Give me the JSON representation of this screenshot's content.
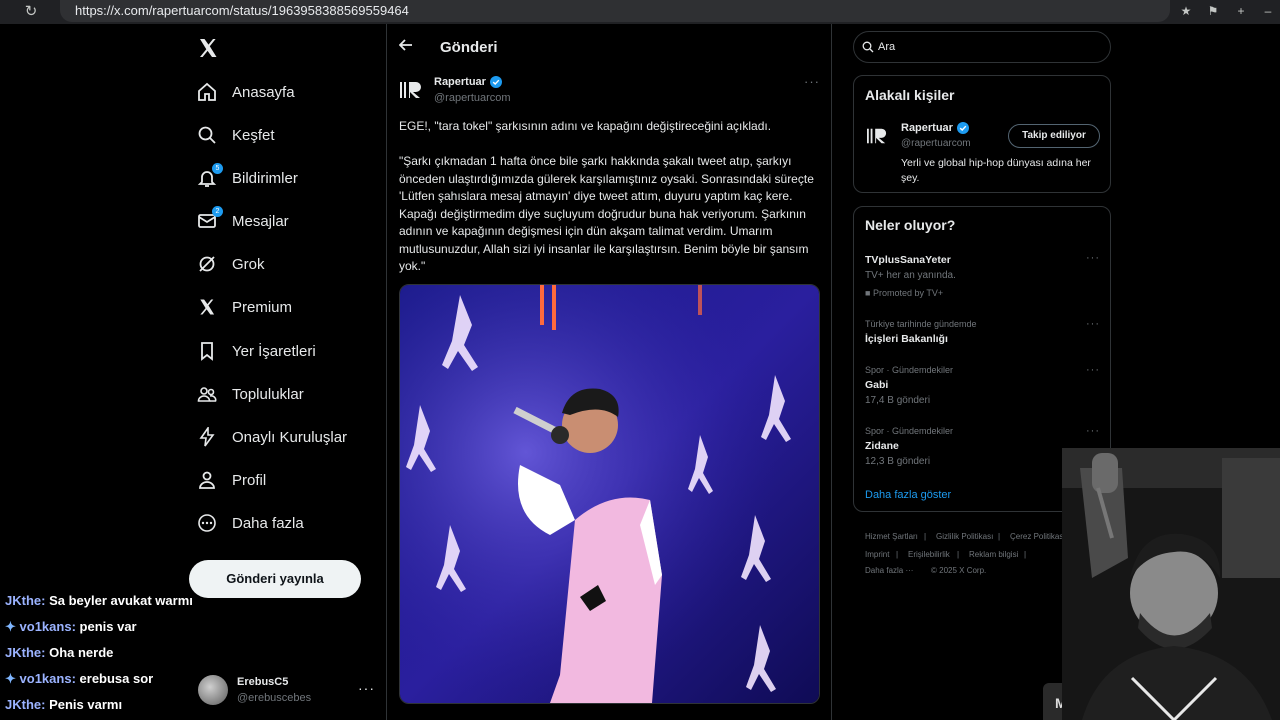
{
  "browser": {
    "url": "https://x.com/rapertuarcom/status/1963958388569559464"
  },
  "nav": {
    "items": [
      {
        "label": "Anasayfa"
      },
      {
        "label": "Keşfet"
      },
      {
        "label": "Bildirimler",
        "badge": "5"
      },
      {
        "label": "Mesajlar",
        "badge": "2"
      },
      {
        "label": "Grok"
      },
      {
        "label": "Premium"
      },
      {
        "label": "Yer İşaretleri"
      },
      {
        "label": "Topluluklar"
      },
      {
        "label": "Onaylı Kuruluşlar"
      },
      {
        "label": "Profil"
      },
      {
        "label": "Daha fazla"
      }
    ],
    "post_button": "Gönderi yayınla",
    "account": {
      "name": "ErebusC5",
      "handle": "@erebuscebes"
    }
  },
  "chat": [
    {
      "user": "JKthe:",
      "msg": "Sa beyler avukat warmı",
      "sword": false
    },
    {
      "user": "vo1kans:",
      "msg": "penis var",
      "sword": true
    },
    {
      "user": "JKthe:",
      "msg": "Oha nerde",
      "sword": false
    },
    {
      "user": "vo1kans:",
      "msg": "erebusa sor",
      "sword": true
    },
    {
      "user": "JKthe:",
      "msg": "Penis varmı",
      "sword": false
    }
  ],
  "tweet": {
    "header_title": "Gönderi",
    "author_name": "Rapertuar",
    "author_handle": "@rapertuarcom",
    "line1": "EGE!, \"tara tokel\" şarkısının adını ve kapağını değiştireceğini açıkladı.",
    "body": "\"Şarkı çıkmadan 1 hafta önce bile şarkı hakkında şakalı tweet atıp, şarkıyı önceden ulaştırdığımızda gülerek karşılamıştınız oysaki. Sonrasındaki süreçte 'Lütfen şahıslara mesaj atmayın' diye tweet attım, duyuru yaptım kaç kere. Kapağı değiştirmedim diye suçluyum doğrudur buna hak veriyorum. Şarkının adının ve kapağının değişmesi için dün akşam talimat verdim. Umarım mutlusunuzdur, Allah sizi iyi insanlar ile karşılaştırsın. Benim böyle bir şansım yok.\""
  },
  "search": {
    "placeholder": "Ara"
  },
  "relevant": {
    "title": "Alakalı kişiler",
    "name": "Rapertuar",
    "handle": "@rapertuarcom",
    "bio": "Yerli ve global hip-hop dünyası adına her şey.",
    "follow_label": "Takip ediliyor"
  },
  "trends": {
    "title": "Neler oluyor?",
    "items": [
      {
        "context": "",
        "name": "TVplusSanaYeter",
        "sub": "TV+ her an yanında.",
        "extra": "Promoted by TV+"
      },
      {
        "context": "Türkiye tarihinde gündemde",
        "name": "İçişleri Bakanlığı",
        "sub": "",
        "extra": ""
      },
      {
        "context": "Spor · Gündemdekiler",
        "name": "Gabi",
        "sub": "17,4 B gönderi",
        "extra": ""
      },
      {
        "context": "Spor · Gündemdekiler",
        "name": "Zidane",
        "sub": "12,3 B gönderi",
        "extra": ""
      }
    ],
    "show_more": "Daha fazla göster"
  },
  "footer": {
    "links": [
      "Hizmet Şartları",
      "Gizlilik Politikası",
      "Çerez Politikası",
      "Imprint",
      "Erişilebilirlik",
      "Reklam bilgisi",
      "Daha fazla ···",
      "© 2025 X Corp."
    ]
  },
  "cam_overlay_letter": "M",
  "colors": {
    "accent": "#1d9bf0",
    "background": "#000000",
    "border": "#2f3336"
  }
}
